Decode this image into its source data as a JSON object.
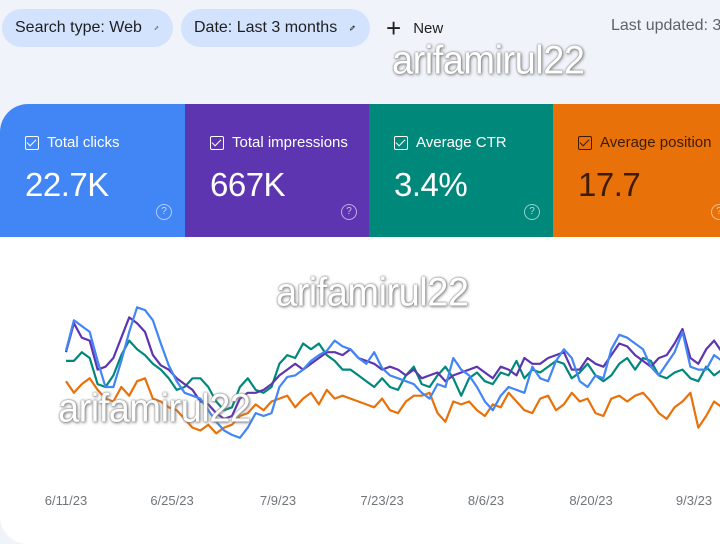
{
  "filters": {
    "search_type": "Search type: Web",
    "date": "Date: Last 3 months",
    "new_label": "New",
    "last_updated": "Last updated: 3"
  },
  "watermark": "arifamirul22",
  "metrics": [
    {
      "label": "Total clicks",
      "value": "22.7K",
      "color": "#4285f4",
      "checked": true
    },
    {
      "label": "Total impressions",
      "value": "667K",
      "color": "#5e35b1",
      "checked": true
    },
    {
      "label": "Average CTR",
      "value": "3.4%",
      "color": "#00897b",
      "checked": true
    },
    {
      "label": "Average position",
      "value": "17.7",
      "color": "#e8710a",
      "checked": true
    }
  ],
  "chart_data": {
    "type": "line",
    "title": "",
    "xlabel": "",
    "ylabel": "",
    "y_axis_visible": false,
    "grid": false,
    "note": "Series values are relative (0-100) heights; the chart shows no y-axis scale.",
    "x_tick_labels": [
      "6/11/23",
      "6/25/23",
      "7/9/23",
      "7/23/23",
      "8/6/23",
      "8/20/23",
      "9/3/23"
    ],
    "ylim": [
      0,
      100
    ],
    "series": [
      {
        "name": "Total clicks",
        "color": "#4285f4",
        "values": [
          65,
          86,
          82,
          78,
          58,
          40,
          40,
          58,
          78,
          95,
          93,
          86,
          70,
          55,
          44,
          36,
          34,
          32,
          24,
          16,
          10,
          7,
          5,
          12,
          22,
          20,
          22,
          40,
          47,
          48,
          52,
          58,
          62,
          65,
          72,
          68,
          66,
          60,
          56,
          64,
          53,
          48,
          46,
          44,
          42,
          36,
          32,
          42,
          40,
          60,
          52,
          48,
          40,
          30,
          24,
          34,
          40,
          38,
          36,
          54,
          46,
          44,
          58,
          66,
          60,
          44,
          40,
          48,
          46,
          66,
          76,
          74,
          70,
          66,
          54,
          48,
          56,
          64,
          78,
          54,
          52,
          52,
          62,
          58
        ]
      },
      {
        "name": "Total impressions",
        "color": "#5e35b1",
        "values": [
          64,
          84,
          74,
          72,
          52,
          54,
          60,
          74,
          88,
          84,
          78,
          62,
          55,
          52,
          46,
          42,
          38,
          30,
          28,
          22,
          18,
          20,
          32,
          36,
          36,
          38,
          42,
          48,
          52,
          56,
          52,
          56,
          60,
          64,
          64,
          62,
          66,
          60,
          58,
          56,
          52,
          54,
          52,
          48,
          52,
          46,
          48,
          50,
          44,
          48,
          50,
          52,
          54,
          50,
          46,
          54,
          52,
          48,
          60,
          56,
          56,
          60,
          62,
          64,
          52,
          52,
          60,
          56,
          54,
          62,
          70,
          68,
          62,
          58,
          54,
          60,
          62,
          70,
          80,
          60,
          56,
          66,
          72,
          64
        ]
      },
      {
        "name": "Average CTR",
        "color": "#00897b",
        "values": [
          58,
          58,
          64,
          60,
          42,
          40,
          48,
          62,
          72,
          66,
          62,
          56,
          52,
          46,
          38,
          40,
          46,
          46,
          40,
          30,
          24,
          26,
          40,
          46,
          38,
          36,
          40,
          56,
          62,
          60,
          70,
          66,
          70,
          62,
          58,
          52,
          52,
          48,
          44,
          40,
          46,
          40,
          38,
          48,
          54,
          42,
          40,
          48,
          54,
          46,
          34,
          46,
          50,
          44,
          42,
          50,
          48,
          58,
          46,
          52,
          50,
          54,
          58,
          56,
          46,
          50,
          56,
          48,
          44,
          48,
          56,
          60,
          52,
          60,
          58,
          48,
          46,
          50,
          52,
          46,
          44,
          54,
          48,
          52
        ]
      },
      {
        "name": "Average position",
        "color": "#e8710a",
        "values": [
          44,
          36,
          42,
          46,
          38,
          32,
          30,
          40,
          34,
          44,
          46,
          32,
          30,
          26,
          24,
          18,
          12,
          10,
          14,
          8,
          12,
          14,
          20,
          22,
          28,
          24,
          30,
          32,
          34,
          26,
          32,
          36,
          28,
          38,
          32,
          34,
          32,
          30,
          28,
          26,
          32,
          24,
          22,
          30,
          34,
          34,
          36,
          22,
          16,
          30,
          28,
          30,
          24,
          20,
          28,
          26,
          36,
          30,
          24,
          22,
          32,
          34,
          24,
          28,
          36,
          30,
          32,
          22,
          20,
          32,
          34,
          30,
          34,
          36,
          30,
          22,
          18,
          26,
          30,
          36,
          12,
          20,
          30,
          26
        ]
      }
    ]
  }
}
